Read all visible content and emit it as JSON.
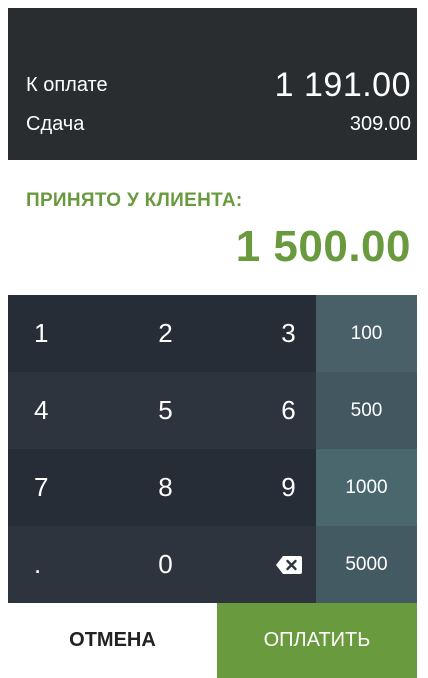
{
  "totals": {
    "due_label": "К оплате",
    "due_value": "1 191.00",
    "change_label": "Сдача",
    "change_value": "309.00"
  },
  "received": {
    "label": "ПРИНЯТО У КЛИЕНТА:",
    "value": "1 500.00"
  },
  "keypad": {
    "k1": "1",
    "k2": "2",
    "k3": "3",
    "k4": "4",
    "k5": "5",
    "k6": "6",
    "k7": "7",
    "k8": "8",
    "k9": "9",
    "dot": ".",
    "k0": "0",
    "backspace_icon": "backspace-icon",
    "presets": [
      "100",
      "500",
      "1000",
      "5000"
    ]
  },
  "actions": {
    "cancel_label": "ОТМЕНА",
    "pay_label": "ОПЛАТИТЬ"
  },
  "colors": {
    "accent_green": "#6a9a3e",
    "header_dark": "#2a2d2f",
    "keypad_dark": "#272d36",
    "preset_teal": "#4a6068"
  }
}
